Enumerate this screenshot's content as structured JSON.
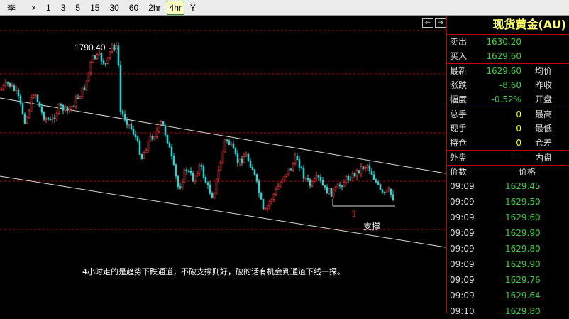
{
  "toolbar": {
    "periods": [
      "季",
      "×",
      "1",
      "3",
      "5",
      "15",
      "30",
      "60",
      "2hr",
      "4hr",
      "Y"
    ],
    "active": "4hr"
  },
  "chart": {
    "peak_label": "1790.40",
    "support_arrow": "⇧",
    "support_label": "支撑",
    "comment": "4小时走的是趋势下跌通道，不破支撑则好，破的话有机会到通道下线一探。",
    "nav_left_icon": "⇐",
    "nav_right_icon": "⇒",
    "colors": {
      "up": "#ff3a3a",
      "down": "#2fd0d0",
      "gridline": "#c00000",
      "channel": "#d8d8d8"
    }
  },
  "panel": {
    "title": "现货黄金(AU)",
    "sell_label": "卖出",
    "sell_value": "1630.20",
    "buy_label": "买入",
    "buy_value": "1629.60",
    "stats": [
      {
        "label": "最新",
        "value": "1629.60",
        "color": "green",
        "label2": "均价"
      },
      {
        "label": "涨跌",
        "value": "-8.60",
        "color": "green",
        "label2": "昨收"
      },
      {
        "label": "幅度",
        "value": "-0.52%",
        "color": "green",
        "label2": "开盘"
      },
      {
        "label": "总手",
        "value": "0",
        "color": "yellow",
        "label2": "最高"
      },
      {
        "label": "现手",
        "value": "0",
        "color": "yellow",
        "label2": "最低"
      },
      {
        "label": "持仓",
        "value": "0",
        "color": "yellow",
        "label2": "仓差"
      },
      {
        "label": "外盘",
        "value": "---",
        "color": "red",
        "label2": "内盘"
      }
    ],
    "ticks_header": {
      "time": "价数",
      "price": "价格"
    },
    "ticks": [
      {
        "time": "09:09",
        "price": "1629.45"
      },
      {
        "time": "09:09",
        "price": "1629.50"
      },
      {
        "time": "09:09",
        "price": "1629.60"
      },
      {
        "time": "09:09",
        "price": "1629.90"
      },
      {
        "time": "09:09",
        "price": "1629.80"
      },
      {
        "time": "09:09",
        "price": "1629.90"
      },
      {
        "time": "09:09",
        "price": "1629.76"
      },
      {
        "time": "09:09",
        "price": "1629.64"
      },
      {
        "time": "09:10",
        "price": "1629.80"
      }
    ]
  }
}
